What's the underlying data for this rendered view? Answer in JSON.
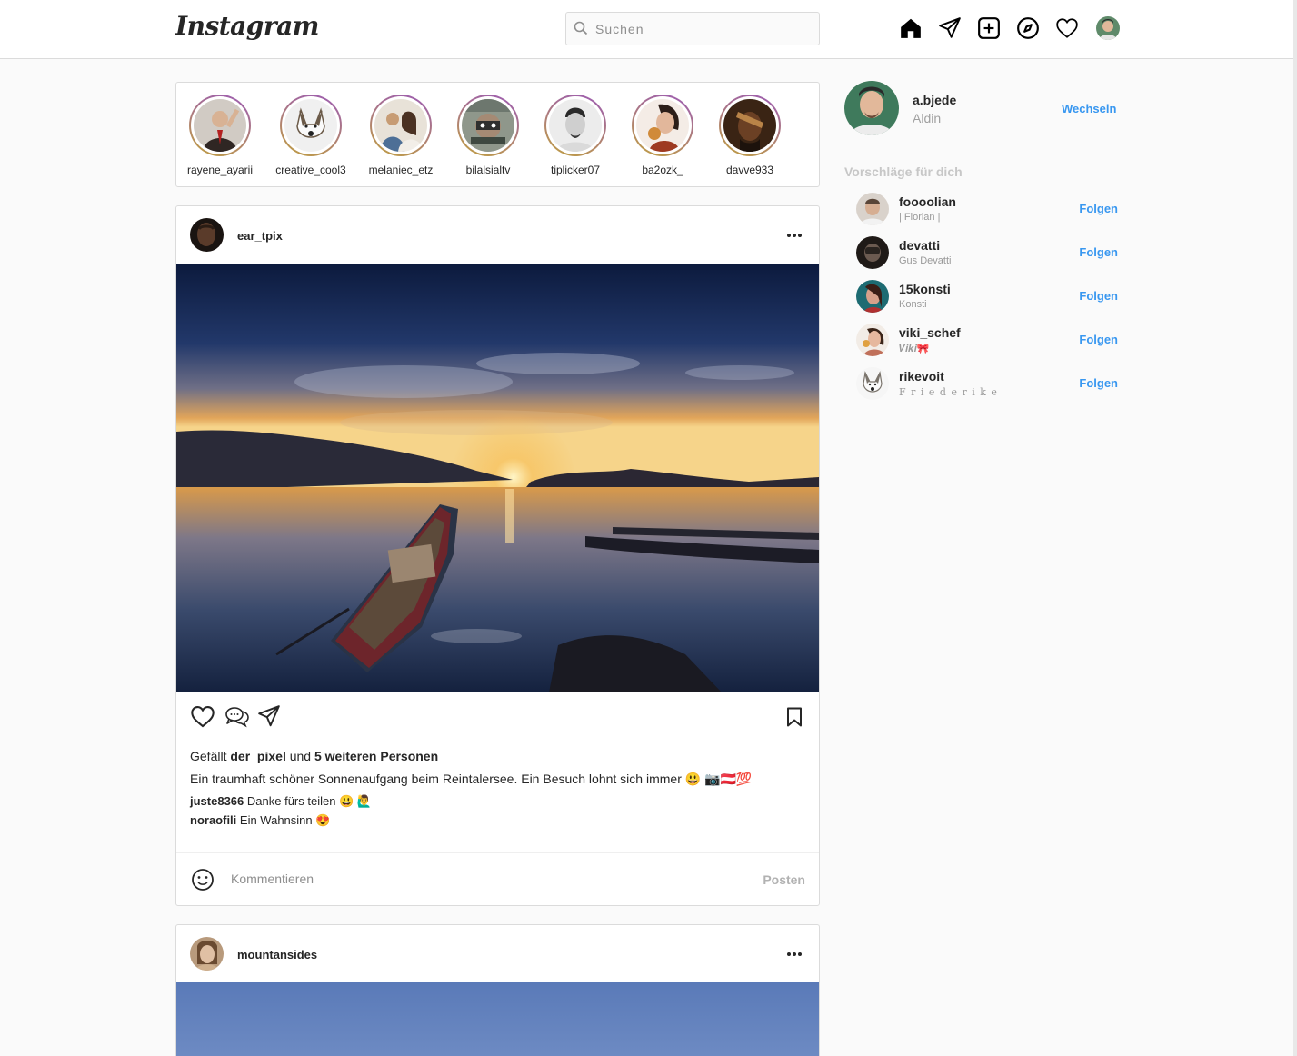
{
  "header": {
    "logo": "Instagram",
    "search_placeholder": "Suchen"
  },
  "stories": [
    {
      "username": "rayene_ayarii",
      "colors": [
        "#cfc9c2",
        "#3a2e2a"
      ]
    },
    {
      "username": "creative_cool3",
      "colors": [
        "#eeeeee",
        "#6b5a48"
      ]
    },
    {
      "username": "melaniec_etz",
      "colors": [
        "#c79c74",
        "#4d6f96"
      ]
    },
    {
      "username": "bilalsialtv",
      "colors": [
        "#8f978b",
        "#3e4840"
      ]
    },
    {
      "username": "tiplicker07",
      "colors": [
        "#e8e8e8",
        "#2a2a2a"
      ]
    },
    {
      "username": "ba2ozk_",
      "colors": [
        "#f0e6de",
        "#9e3a22"
      ]
    },
    {
      "username": "davve933",
      "colors": [
        "#3a2414",
        "#b98448"
      ]
    }
  ],
  "posts": [
    {
      "username": "ear_tpix",
      "likes_prefix": "Gefällt",
      "likes_user": "der_pixel",
      "likes_middle": "und",
      "likes_others": "5 weiteren Personen",
      "caption": "Ein traumhaft schöner Sonnenaufgang beim Reintalersee. Ein Besuch lohnt sich immer 😃 📷🇦🇹💯",
      "comments": [
        {
          "user": "juste8366",
          "text": "Danke fürs teilen 😃 🙋‍♂️"
        },
        {
          "user": "noraofili",
          "text": "Ein Wahnsinn 😍"
        }
      ],
      "comment_placeholder": "Kommentieren",
      "post_button": "Posten"
    },
    {
      "username": "mountansides"
    }
  ],
  "sidebar": {
    "username": "a.bjede",
    "name": "Aldin",
    "switch_label": "Wechseln",
    "suggestions_title": "Vorschläge für dich",
    "follow_label": "Folgen",
    "suggestions": [
      {
        "username": "foooolian",
        "name": "| Florian |",
        "colors": [
          "#d9d2cb",
          "#5a4638"
        ]
      },
      {
        "username": "devatti",
        "name": "Gus Devatti",
        "colors": [
          "#6b5a50",
          "#1f1a17"
        ]
      },
      {
        "username": "15konsti",
        "name": "Konsti",
        "colors": [
          "#1d6b72",
          "#d6a08a"
        ]
      },
      {
        "username": "viki_schef",
        "name": "𝑽𝒊𝒌𝒊🎀",
        "colors": [
          "#f2ece6",
          "#c0705a"
        ]
      },
      {
        "username": "rikevoit",
        "name": "F r i e d e r i k e",
        "colors": [
          "#f4f4f4",
          "#7a746c"
        ]
      }
    ]
  }
}
